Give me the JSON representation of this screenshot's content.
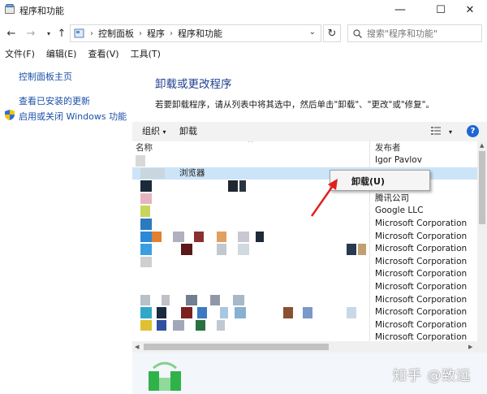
{
  "window": {
    "title": "程序和功能",
    "minimize_glyph": "—",
    "maximize_glyph": "☐",
    "close_glyph": "✕"
  },
  "address": {
    "breadcrumbs": [
      "控制面板",
      "程序",
      "程序和功能"
    ],
    "search_placeholder": "搜索\"程序和功能\""
  },
  "menu": [
    "文件(F)",
    "编辑(E)",
    "查看(V)",
    "工具(T)"
  ],
  "sidebar": {
    "home": "控制面板主页",
    "updates": "查看已安装的更新",
    "features": "启用或关闭 Windows 功能"
  },
  "main": {
    "heading": "卸载或更改程序",
    "description": "若要卸载程序，请从列表中将其选中，然后单击\"卸载\"、\"更改\"或\"修复\"。"
  },
  "toolbar": {
    "organize": "组织",
    "uninstall": "卸载"
  },
  "list": {
    "columns": {
      "name": "名称",
      "publisher": "发布者"
    },
    "selected_name": "浏览器",
    "publishers": [
      "Igor Pavlov",
      "",
      "",
      "腾讯公司",
      "Google LLC",
      "Microsoft Corporation",
      "Microsoft Corporation",
      "Microsoft Corporation",
      "Microsoft Corporation",
      "Microsoft Corporation",
      "Microsoft Corporation",
      "Microsoft Corporation",
      "Microsoft Corporation",
      "Microsoft Corporation",
      "Microsoft Corporation"
    ]
  },
  "context_menu": {
    "uninstall": "卸载(U)"
  },
  "watermark": "知乎 @致远",
  "colors": {
    "link": "#1b4fa8",
    "heading": "#1e3f8e",
    "selection": "#cce4f7",
    "annotation_arrow": "#e02020",
    "help": "#1e66d0"
  }
}
